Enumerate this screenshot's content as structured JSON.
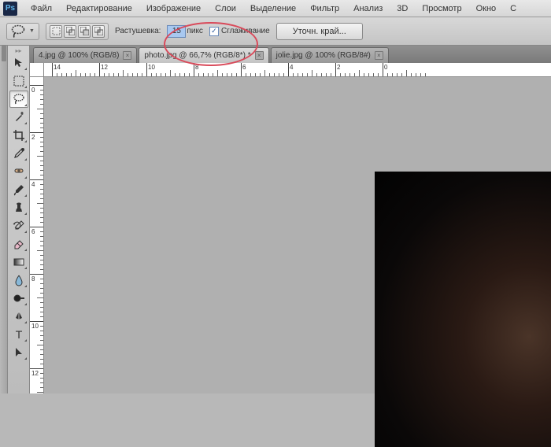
{
  "menu": {
    "items": [
      "Файл",
      "Редактирование",
      "Изображение",
      "Слои",
      "Выделение",
      "Фильтр",
      "Анализ",
      "3D",
      "Просмотр",
      "Окно",
      "С"
    ]
  },
  "options": {
    "feather_label": "Растушевка:",
    "feather_value": "15",
    "feather_unit": "пикс",
    "antialias_label": "Сглаживание",
    "refine_label": "Уточн. край..."
  },
  "tabs": [
    {
      "label": "4.jpg @ 100% (RGB/8)",
      "active": false
    },
    {
      "label": "photo.jpg @ 66,7% (RGB/8*) *",
      "active": true
    },
    {
      "label": "jolie.jpg @ 100% (RGB/8#)",
      "active": false
    }
  ],
  "ruler_h": [
    "14",
    "12",
    "10",
    "8",
    "6",
    "4",
    "2",
    "0"
  ],
  "ruler_v": [
    "0",
    "2",
    "4",
    "6",
    "8",
    "10",
    "12"
  ]
}
